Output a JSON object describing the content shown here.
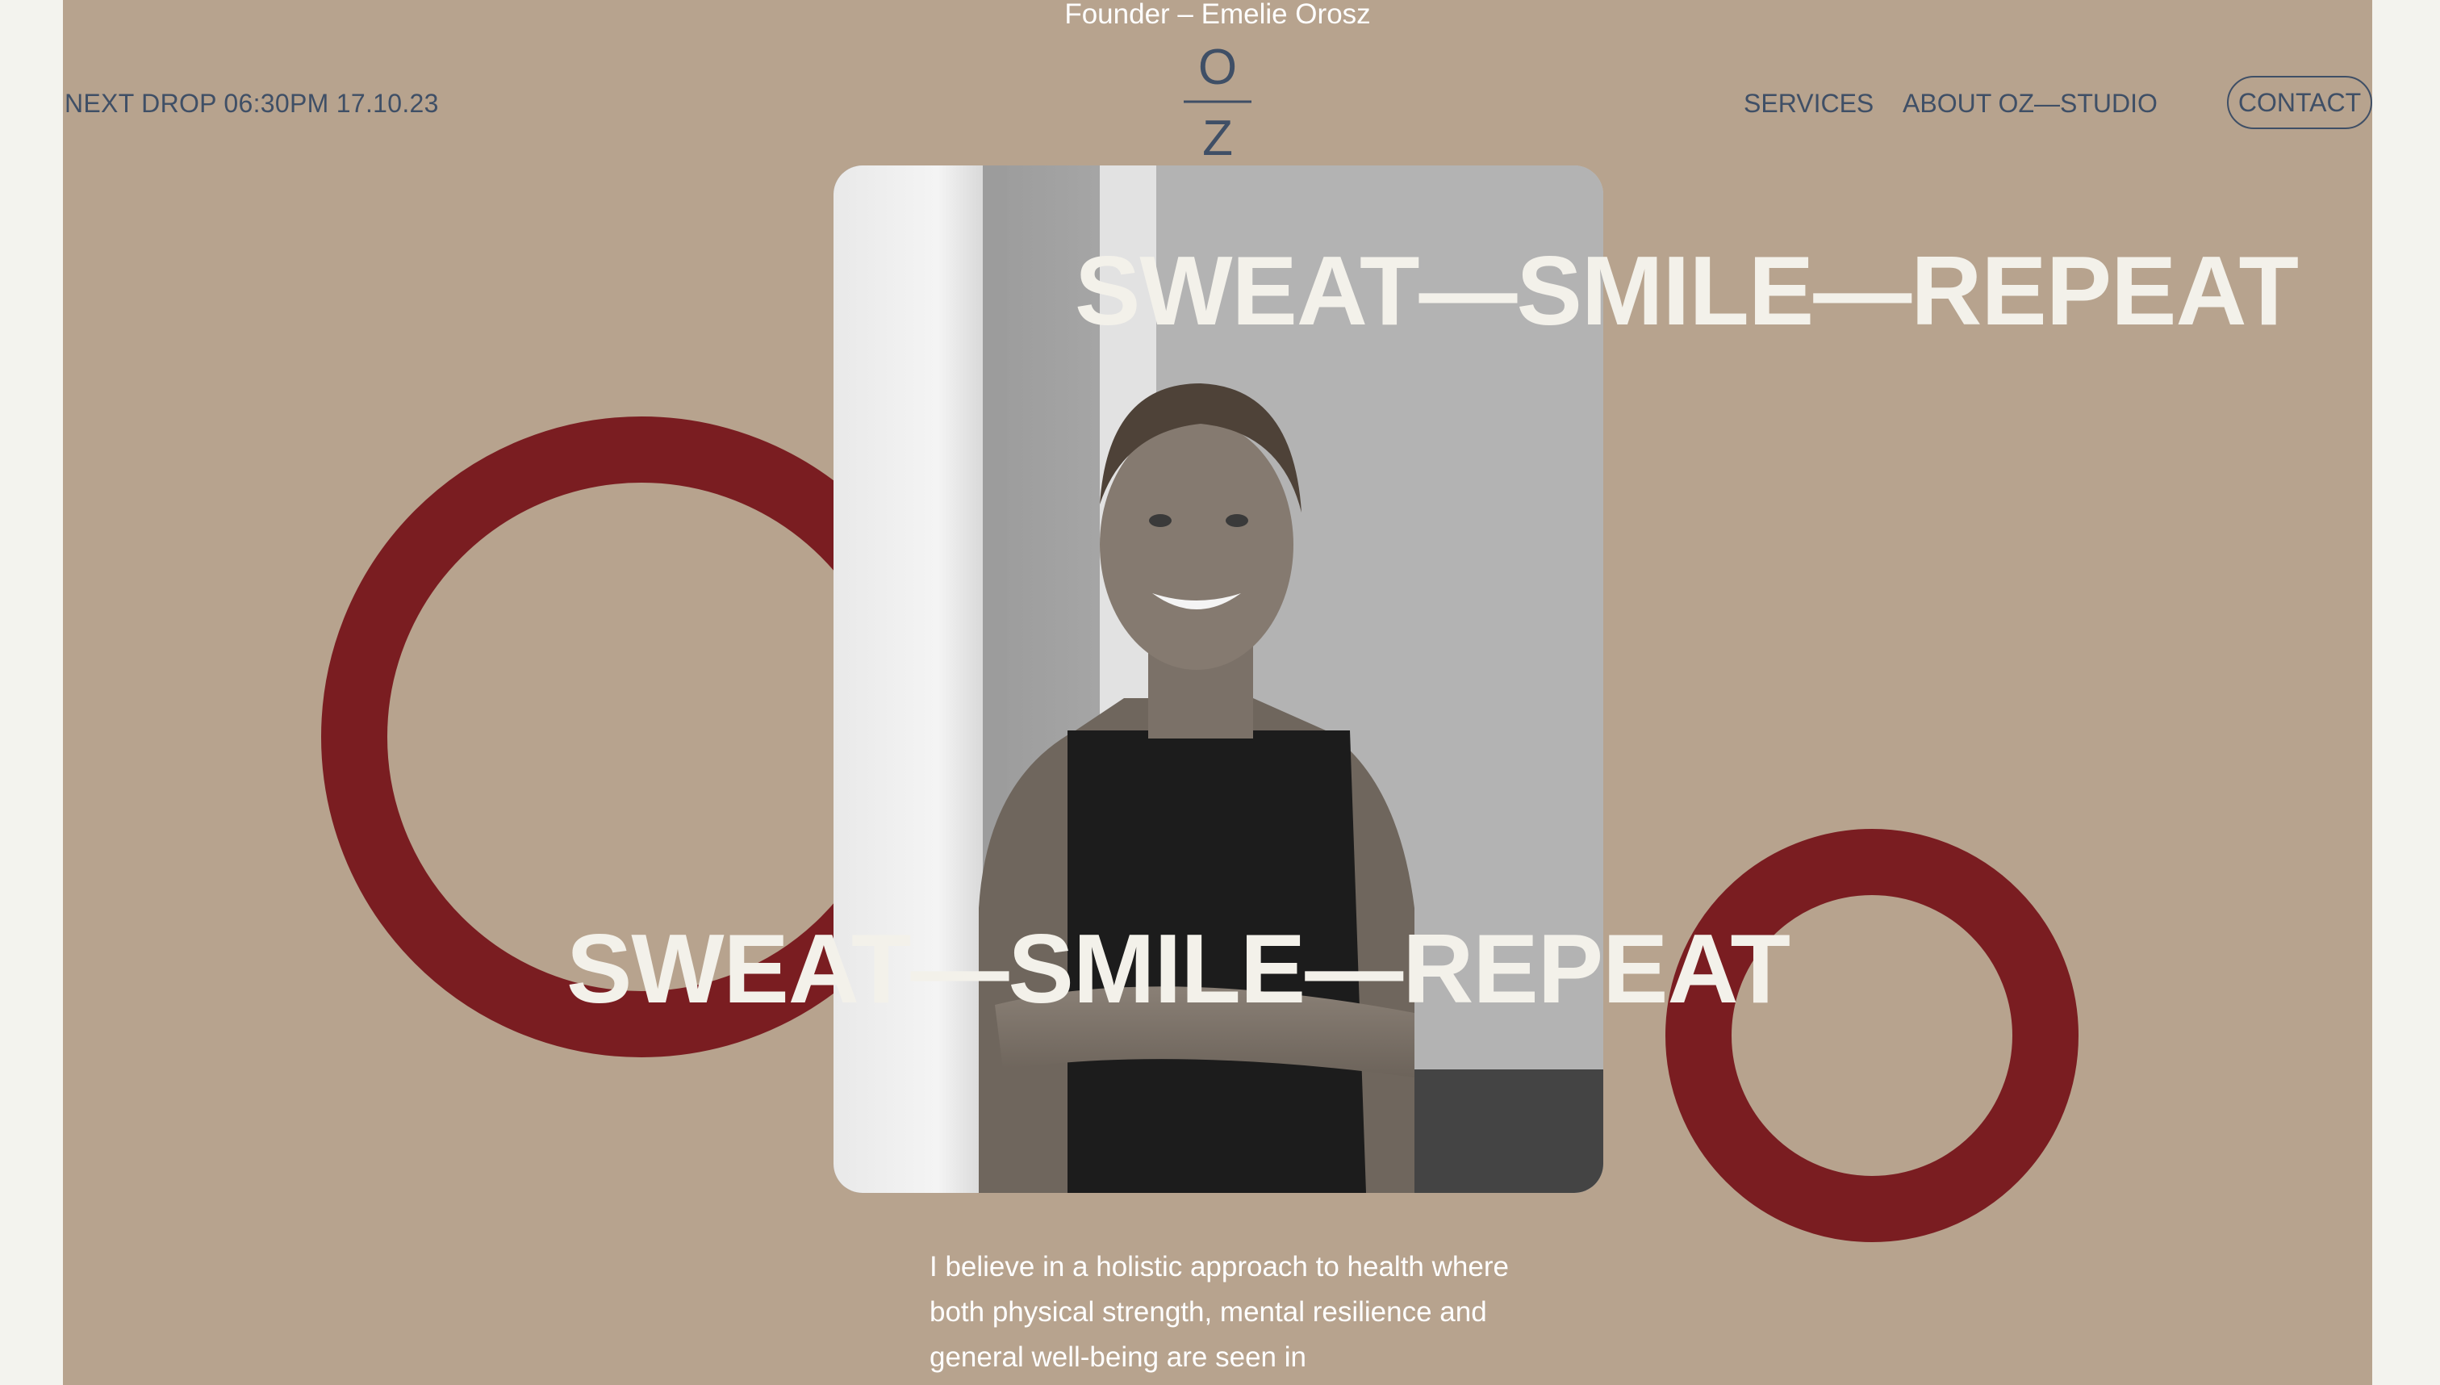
{
  "header": {
    "founder": "Founder – Emelie Orosz",
    "next_drop": "NEXT DROP 06:30PM 17.10.23",
    "logo": {
      "top": "O",
      "bottom": "Z"
    }
  },
  "nav": {
    "services": "SERVICES",
    "about": "ABOUT OZ—STUDIO",
    "contact": "CONTACT"
  },
  "hero": {
    "headline_top": "SWEAT—SMILE—REPEAT",
    "headline_bottom": "SWEAT—SMILE—REPEAT"
  },
  "body": {
    "quote": "I believe in a holistic approach to health where both physical strength, mental resilience and general well-being are seen in"
  },
  "colors": {
    "background": "#b7a38e",
    "accent_ring": "#7a1d21",
    "nav_text": "#3f4f66",
    "headline": "#f3f1ea",
    "page_margin": "#f3f3ee"
  }
}
